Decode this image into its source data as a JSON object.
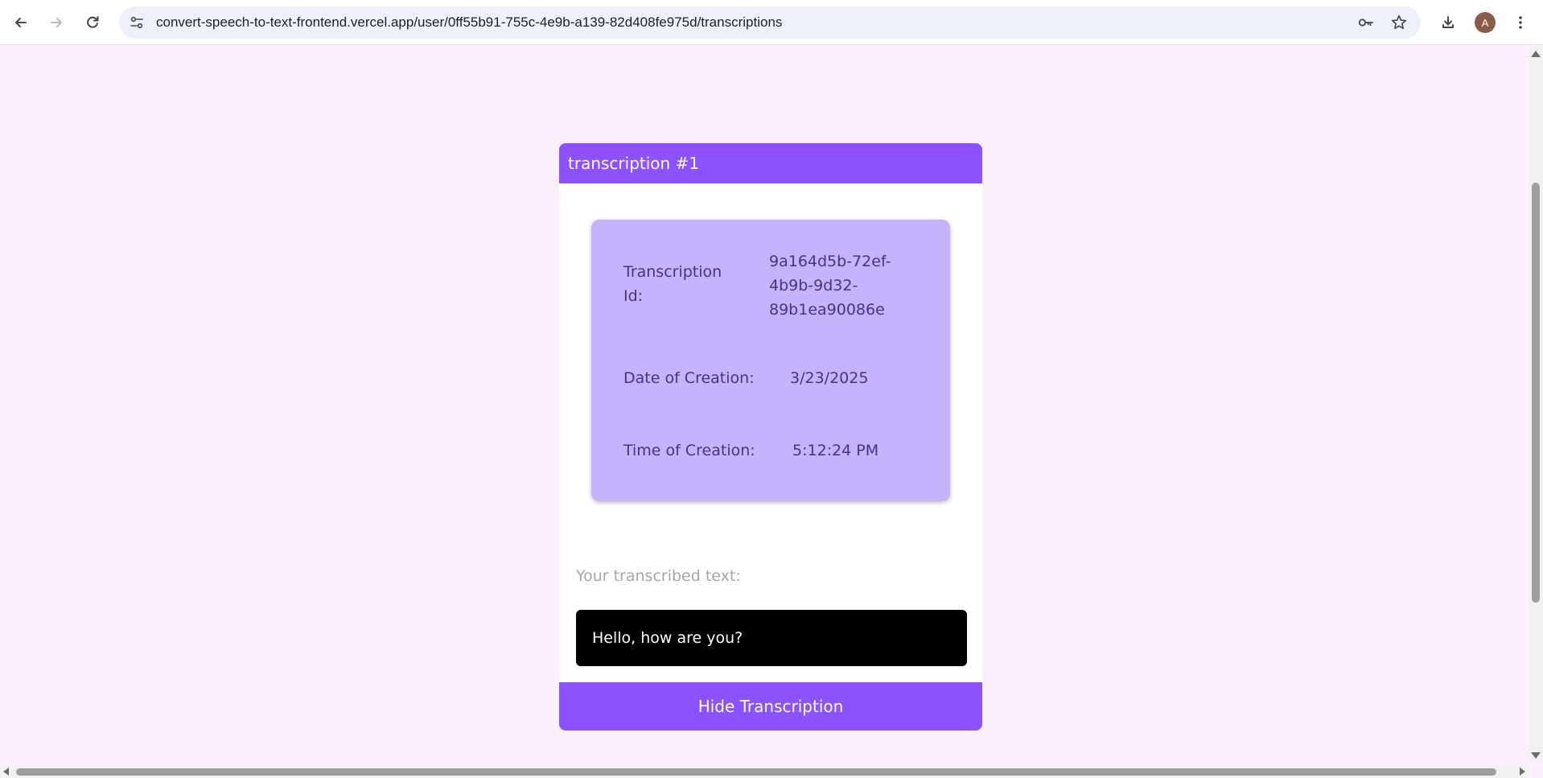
{
  "browser": {
    "url": "convert-speech-to-text-frontend.vercel.app/user/0ff55b91-755c-4e9b-a139-82d408fe975d/transcriptions",
    "profile_initial": "A",
    "icons": [
      "back-icon",
      "forward-icon",
      "reload-icon",
      "site-settings-icon",
      "key-icon",
      "star-icon",
      "download-icon",
      "kebab-menu-icon"
    ]
  },
  "card": {
    "title": "transcription #1",
    "id_label_line1": "Transcription",
    "id_label_line2": "Id:",
    "id_value_line1": "9a164d5b-72ef-",
    "id_value_line2": "4b9b-9d32-",
    "id_value_line3": "89b1ea90086e",
    "date_label": "Date of Creation:",
    "date_value": "3/23/2025",
    "time_label": "Time of Creation:",
    "time_value": "5:12:24 PM",
    "text_label": "Your transcribed text:",
    "text_value": "Hello, how are you?",
    "hide_button": "Hide Transcription"
  },
  "colors": {
    "page_background": "#fdf0fe",
    "accent": "#8b52fd",
    "info_box": "#c4b3fd",
    "info_text": "#4b2f8e",
    "text_box": "#000000"
  }
}
